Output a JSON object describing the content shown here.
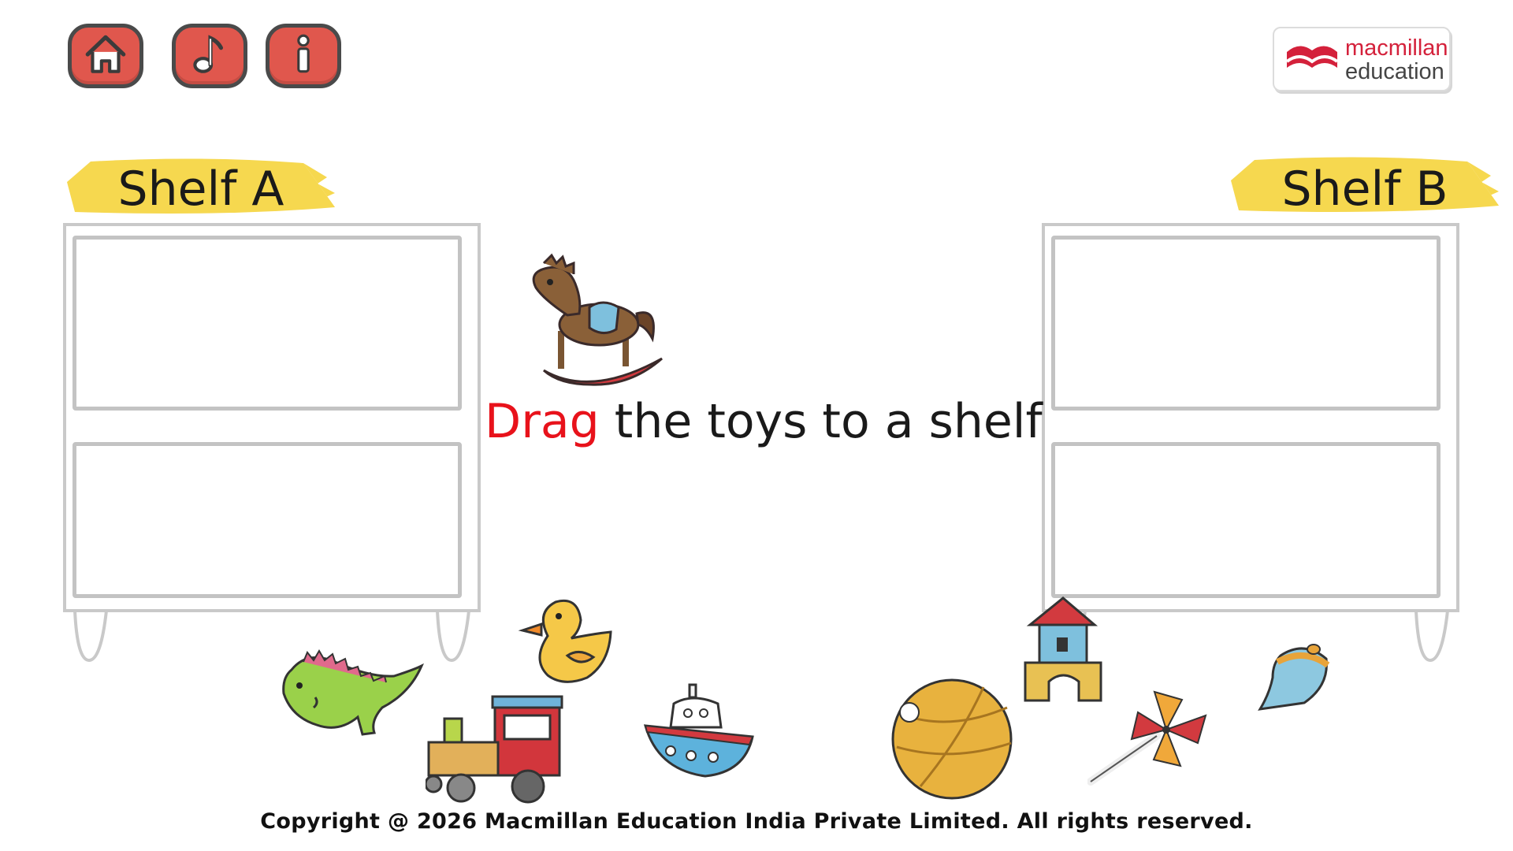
{
  "toolbar": {
    "home": {
      "label": "Home",
      "icon": "home-icon"
    },
    "music": {
      "label": "Music",
      "icon": "music-note-icon"
    },
    "info": {
      "label": "Info",
      "icon": "info-icon"
    },
    "button_color": "#e0574d"
  },
  "logo": {
    "line1": "macmillan",
    "line2": "education",
    "brand_color": "#d4213b"
  },
  "shelf_a": {
    "label": "Shelf A"
  },
  "shelf_b": {
    "label": "Shelf B"
  },
  "instruction": {
    "highlight": "Drag",
    "rest": " the toys to a shelf",
    "highlight_color": "#e8121b"
  },
  "toys": [
    {
      "name": "rocking-horse",
      "icon": "rocking-horse-icon"
    },
    {
      "name": "dinosaur",
      "icon": "dinosaur-icon"
    },
    {
      "name": "train",
      "icon": "train-icon"
    },
    {
      "name": "duck",
      "icon": "duck-icon"
    },
    {
      "name": "boat",
      "icon": "boat-icon"
    },
    {
      "name": "ball",
      "icon": "ball-icon"
    },
    {
      "name": "blocks-house",
      "icon": "blocks-house-icon"
    },
    {
      "name": "pinwheel",
      "icon": "pinwheel-icon"
    },
    {
      "name": "spinning-top",
      "icon": "spinning-top-icon"
    }
  ],
  "footer": {
    "copyright": "Copyright @ 2026 Macmillan Education India Private Limited. All rights reserved."
  }
}
